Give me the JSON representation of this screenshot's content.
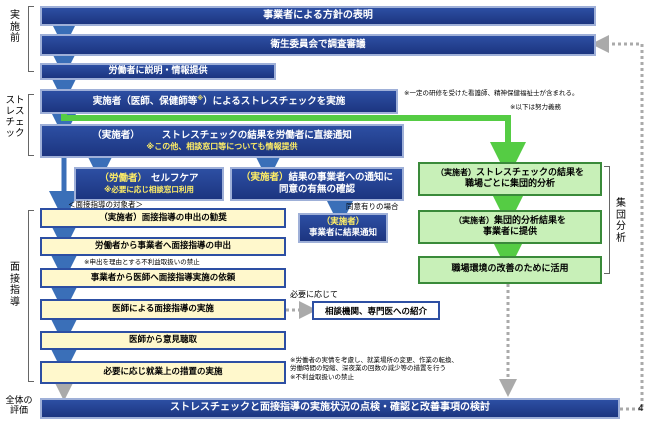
{
  "sections": {
    "pre": "実施前",
    "stress": "ストレスチェック",
    "interview": "面接指導",
    "group": "集団分析",
    "overall": "全体の評価"
  },
  "boxes": {
    "policy": "事業者による方針の表明",
    "committee": "衛生委員会で調査審議",
    "explain": "労働者に説明・情報提供",
    "implement": "実施者（医師、保健師等",
    "implement_sup": "※",
    "implement_tail": "）によるストレスチェックを実施",
    "notify_tag": "（実施者）",
    "notify_main": "ストレスチェックの結果を労働者に直接通知",
    "notify_sub": "※この他、相談窓口等についても情報提供",
    "selfcare_tag": "（労働者）",
    "selfcare_main": "セルフケア",
    "selfcare_sub": "※必要に応じ相談窓口利用",
    "consent_tag": "（実施者）",
    "consent_line1": "結果の事業者への通知に",
    "consent_line2": "同意の有無の確認",
    "employer_notify_tag": "（実施者）",
    "employer_notify": "事業者に結果通知",
    "group_tag": "（実施者）",
    "group_line1": "ストレスチェックの結果を",
    "group_line2": "職場ごとに集団的分析",
    "provide_tag": "（実施者）",
    "provide_line1": "集団的分析結果を",
    "provide_line2": "事業者に提供",
    "improve": "職場環境の改善のために活用",
    "recommend_tag": "（実施者）",
    "recommend": "面接指導の申出の勧奨",
    "request": "労働者から事業者へ面接指導の申出",
    "ask_doctor": "事業者から医師へ面接指導実施の依頼",
    "doctor_interview": "医師による面接指導の実施",
    "refer": "相談機関、専門医への紹介",
    "opinion": "医師から意見聴取",
    "measures": "必要に応じ就業上の措置の実施",
    "review": "ストレスチェックと面接指導の実施状況の点検・確認と改善事項の検討"
  },
  "notes": {
    "training": "※一定の研修を受けた看護師、精神保健福祉士が含まれる。",
    "effort": "※以下は努力義務",
    "target": "＜面接指導の対象者＞",
    "consent_yes": "同意有りの場合",
    "no_disadvantage1": "※申出を理由とする不利益取扱いの禁止",
    "as_needed": "必要に応じて",
    "measures_note1": "※労働者の実情を考慮し、就業場所の変更、作業の転換、",
    "measures_note2": "労働時間の短縮、深夜業の回数の減少等の措置を行う",
    "measures_note3": "※不利益取扱いの禁止",
    "page_number": "4"
  },
  "colors": {
    "blue": "#2d4fa3",
    "dark_blue": "#1c3580",
    "green": "#6ee05a",
    "yellow_fill": "#fff8cc",
    "green_fill": "#c8f0b8",
    "accent_yellow": "#ffee66"
  }
}
